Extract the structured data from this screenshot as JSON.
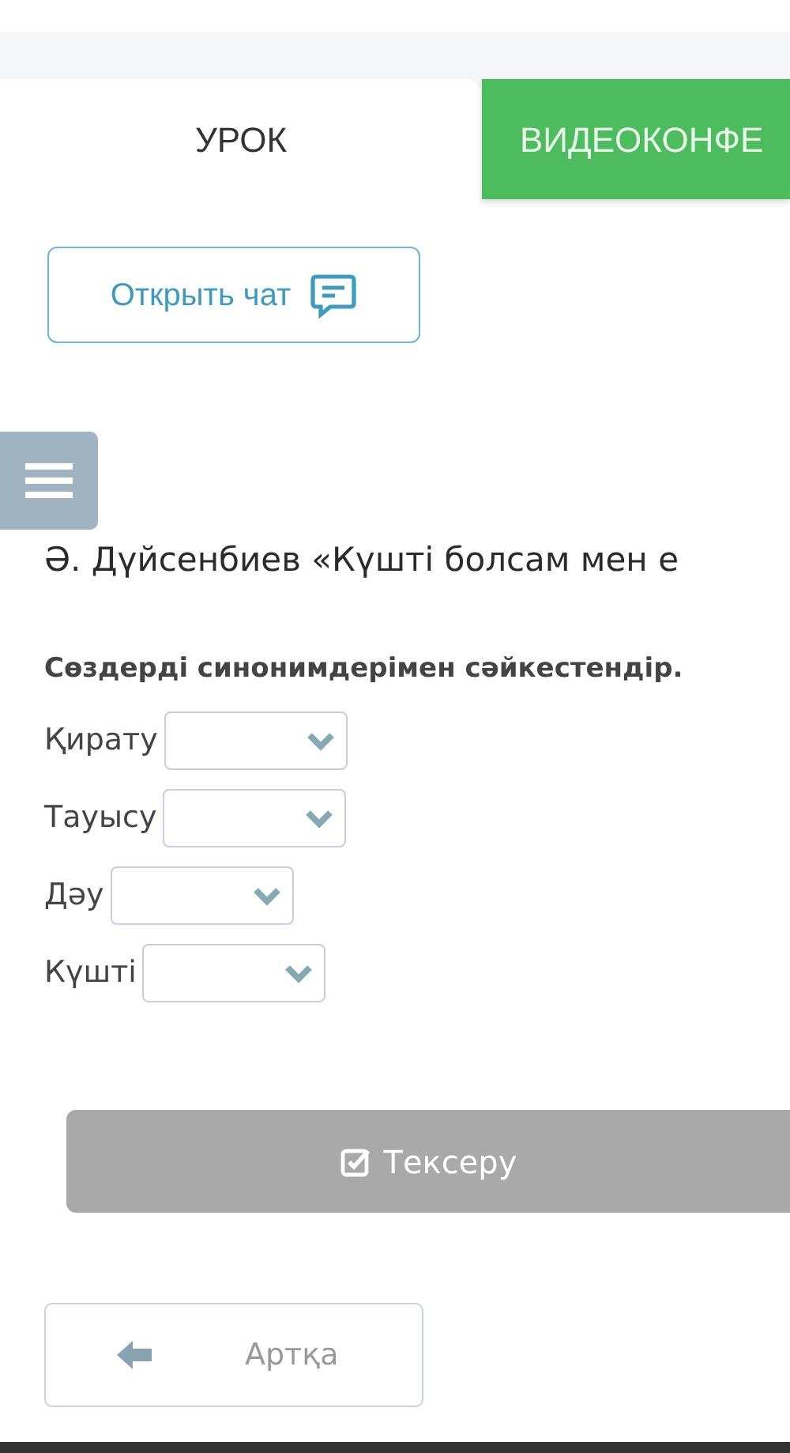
{
  "tabs": [
    {
      "label": "УРОК",
      "selected": true
    },
    {
      "label": "ВИДЕОКОНФЕ",
      "selected": false
    }
  ],
  "chat_button": {
    "label": "Открыть чат"
  },
  "title": "Ә. Дүйсенбиев «Күшті болсам мен е",
  "task": {
    "instruction": "Сөздерді синонимдерімен сәйкестендір.",
    "rows": [
      {
        "word": "Қирату"
      },
      {
        "word": "Тауысу"
      },
      {
        "word": "Дәу"
      },
      {
        "word": "Күшті"
      }
    ]
  },
  "check_button": {
    "label": "Тексеру",
    "disabled": true
  },
  "back_button": {
    "label": "Артқа"
  }
}
